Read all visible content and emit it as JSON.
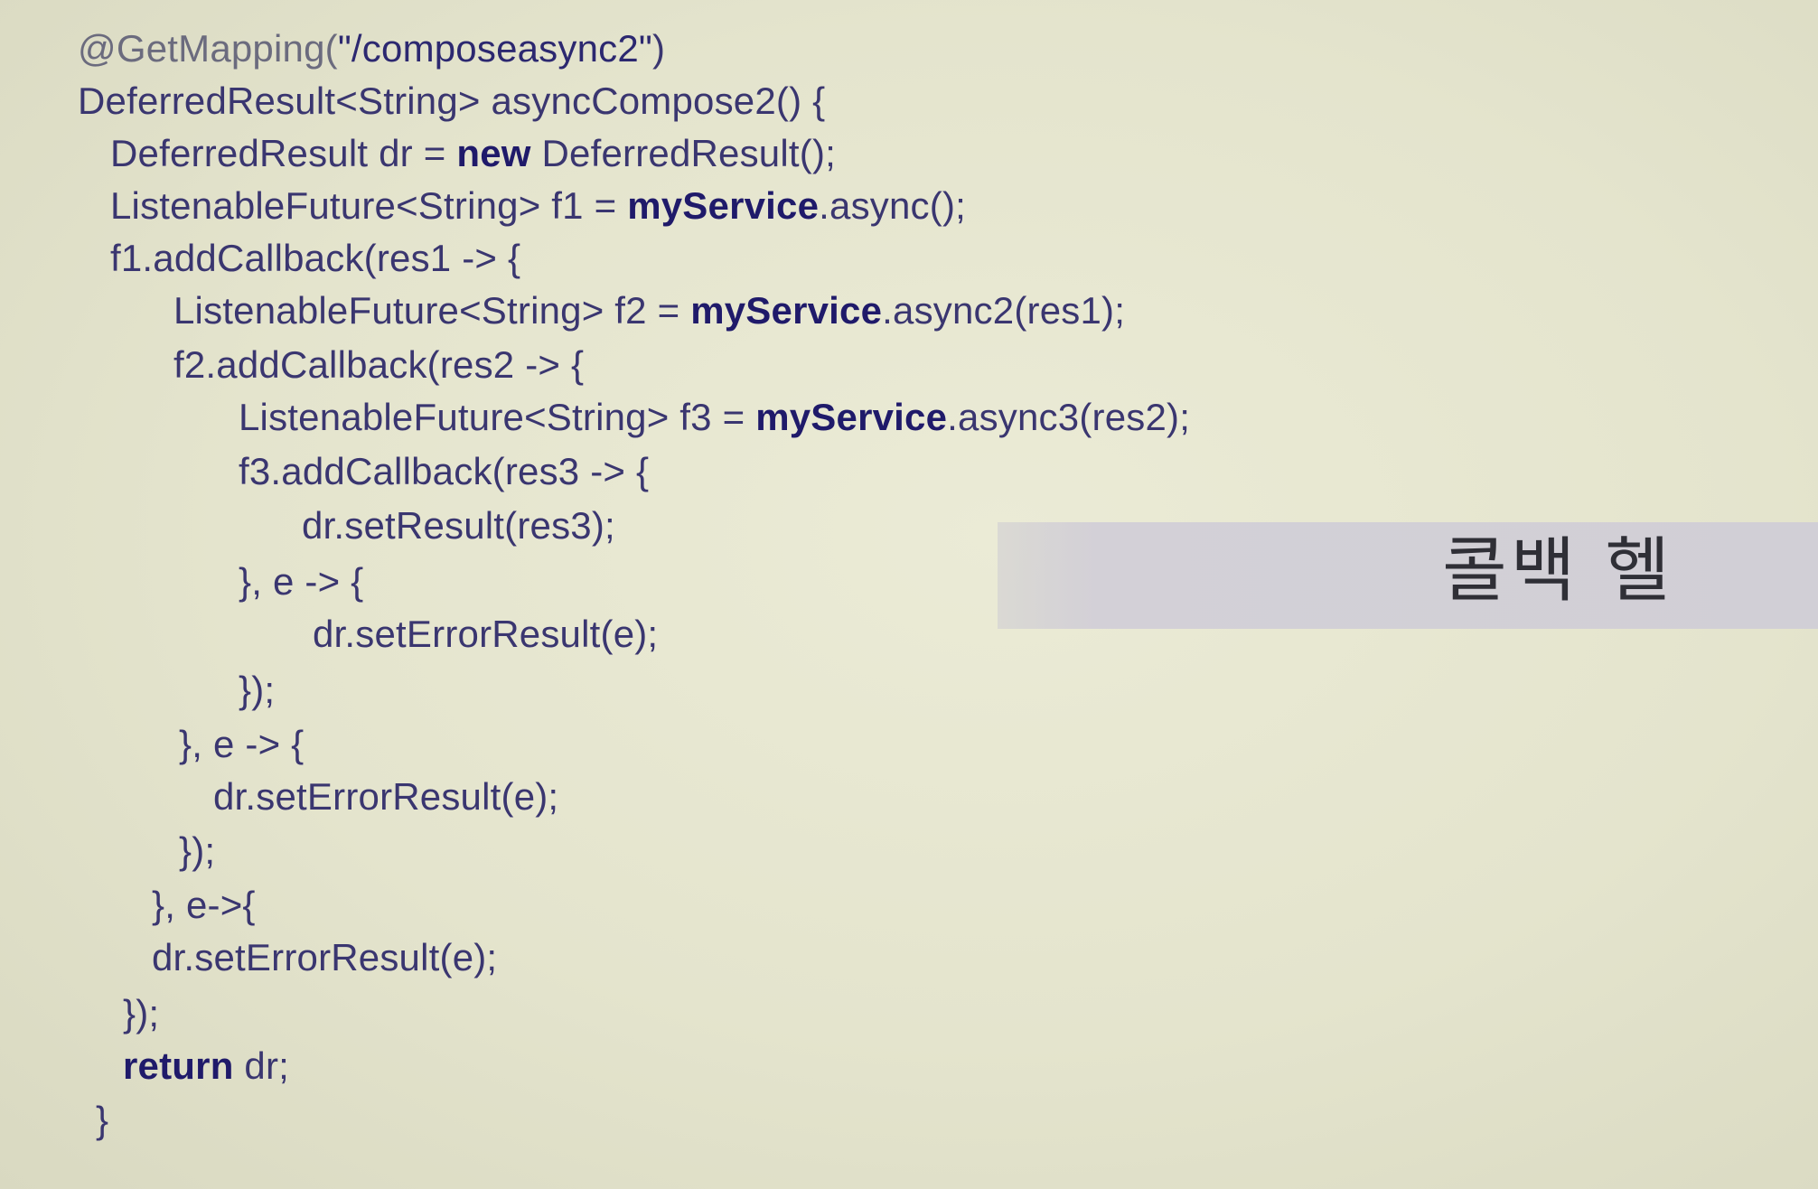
{
  "slide": {
    "code_lines": [
      {
        "segments": [
          {
            "text": "@GetMapping(",
            "style": "ann"
          },
          {
            "text": "\"/composeasync2\"",
            "style": "str"
          },
          {
            "text": ")",
            "style": "plain"
          }
        ]
      },
      {
        "segments": [
          {
            "text": "DeferredResult<String> asyncCompose2() {",
            "style": "plain"
          }
        ]
      },
      {
        "segments": [
          {
            "text": "DeferredResult dr = ",
            "style": "plain"
          },
          {
            "text": "new",
            "style": "kw"
          },
          {
            "text": " DeferredResult();",
            "style": "plain"
          }
        ]
      },
      {
        "segments": [
          {
            "text": "ListenableFuture<String> f1 = ",
            "style": "plain"
          },
          {
            "text": "myService",
            "style": "kw"
          },
          {
            "text": ".async();",
            "style": "plain"
          }
        ]
      },
      {
        "segments": [
          {
            "text": "f1.addCallback(res1 -> {",
            "style": "plain"
          }
        ]
      },
      {
        "segments": [
          {
            "text": "ListenableFuture<String> f2 = ",
            "style": "plain"
          },
          {
            "text": "myService",
            "style": "kw"
          },
          {
            "text": ".async2(res1);",
            "style": "plain"
          }
        ]
      },
      {
        "segments": [
          {
            "text": "f2.addCallback(res2 -> {",
            "style": "plain"
          }
        ]
      },
      {
        "segments": [
          {
            "text": "ListenableFuture<String> f3 = ",
            "style": "plain"
          },
          {
            "text": "myService",
            "style": "kw"
          },
          {
            "text": ".async3(res2);",
            "style": "plain"
          }
        ]
      },
      {
        "segments": [
          {
            "text": "f3.addCallback(res3 -> {",
            "style": "plain"
          }
        ]
      },
      {
        "segments": [
          {
            "text": "dr.setResult(res3);",
            "style": "plain"
          }
        ]
      },
      {
        "segments": [
          {
            "text": "}, e -> {",
            "style": "plain"
          }
        ]
      },
      {
        "segments": [
          {
            "text": "dr.setErrorResult(e);",
            "style": "plain"
          }
        ]
      },
      {
        "segments": [
          {
            "text": "});",
            "style": "plain"
          }
        ]
      },
      {
        "segments": [
          {
            "text": "}, e -> {",
            "style": "plain"
          }
        ]
      },
      {
        "segments": [
          {
            "text": "dr.setErrorResult(e);",
            "style": "plain"
          }
        ]
      },
      {
        "segments": [
          {
            "text": "});",
            "style": "plain"
          }
        ]
      },
      {
        "segments": [
          {
            "text": "}, e->{",
            "style": "plain"
          }
        ]
      },
      {
        "segments": [
          {
            "text": "dr.setErrorResult(e);",
            "style": "plain"
          }
        ]
      },
      {
        "segments": [
          {
            "text": "});",
            "style": "plain"
          }
        ]
      },
      {
        "segments": [
          {
            "text": "return",
            "style": "kw"
          },
          {
            "text": " dr;",
            "style": "plain"
          }
        ]
      },
      {
        "segments": [
          {
            "text": "}",
            "style": "plain"
          }
        ]
      }
    ],
    "callout": {
      "label": "콜백 헬"
    }
  }
}
